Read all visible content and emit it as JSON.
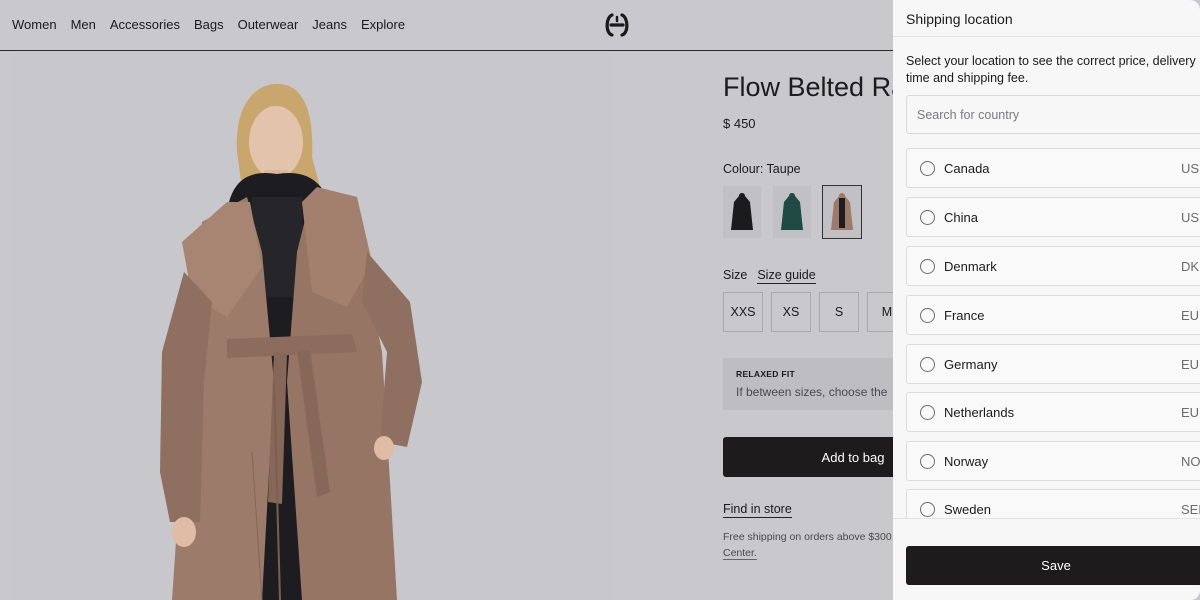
{
  "nav": {
    "items": [
      "Women",
      "Men",
      "Accessories",
      "Bags",
      "Outerwear",
      "Jeans",
      "Explore"
    ]
  },
  "logo": {
    "icon": "brand-logo-icon"
  },
  "product": {
    "title": "Flow Belted Raincoat",
    "price": "$ 450",
    "colour_label": "Colour: Taupe",
    "swatches": [
      {
        "name": "black",
        "color": "#1b1b1d"
      },
      {
        "name": "dark-green",
        "color": "#1f4a44"
      },
      {
        "name": "taupe",
        "color": "#9c7b6a",
        "selected": true
      }
    ],
    "size_label": "Size",
    "size_guide": "Size guide",
    "sizes": [
      "XXS",
      "XS",
      "S",
      "M"
    ],
    "fit_title": "RELAXED FIT",
    "fit_text": "If between sizes, choose the",
    "add_button": "Add to bag",
    "find_in_store": "Find in store",
    "shipping_note_1": "Free shipping on orders above $300",
    "shipping_note_2": "Center."
  },
  "panel": {
    "title": "Shipping location",
    "description": "Select your location to see the correct price, delivery time and shipping fee.",
    "search_placeholder": "Search for country",
    "countries": [
      {
        "name": "Canada",
        "currency": "USD"
      },
      {
        "name": "China",
        "currency": "USD"
      },
      {
        "name": "Denmark",
        "currency": "DKK"
      },
      {
        "name": "France",
        "currency": "EUR"
      },
      {
        "name": "Germany",
        "currency": "EUR"
      },
      {
        "name": "Netherlands",
        "currency": "EUR"
      },
      {
        "name": "Norway",
        "currency": "NOK"
      },
      {
        "name": "Sweden",
        "currency": "SEK"
      }
    ],
    "save_button": "Save"
  },
  "colors": {
    "background": "#c9c8cd",
    "panel": "#f7f7f8",
    "dark_button": "#1e1b1c",
    "coat": "#9c7b6a"
  }
}
